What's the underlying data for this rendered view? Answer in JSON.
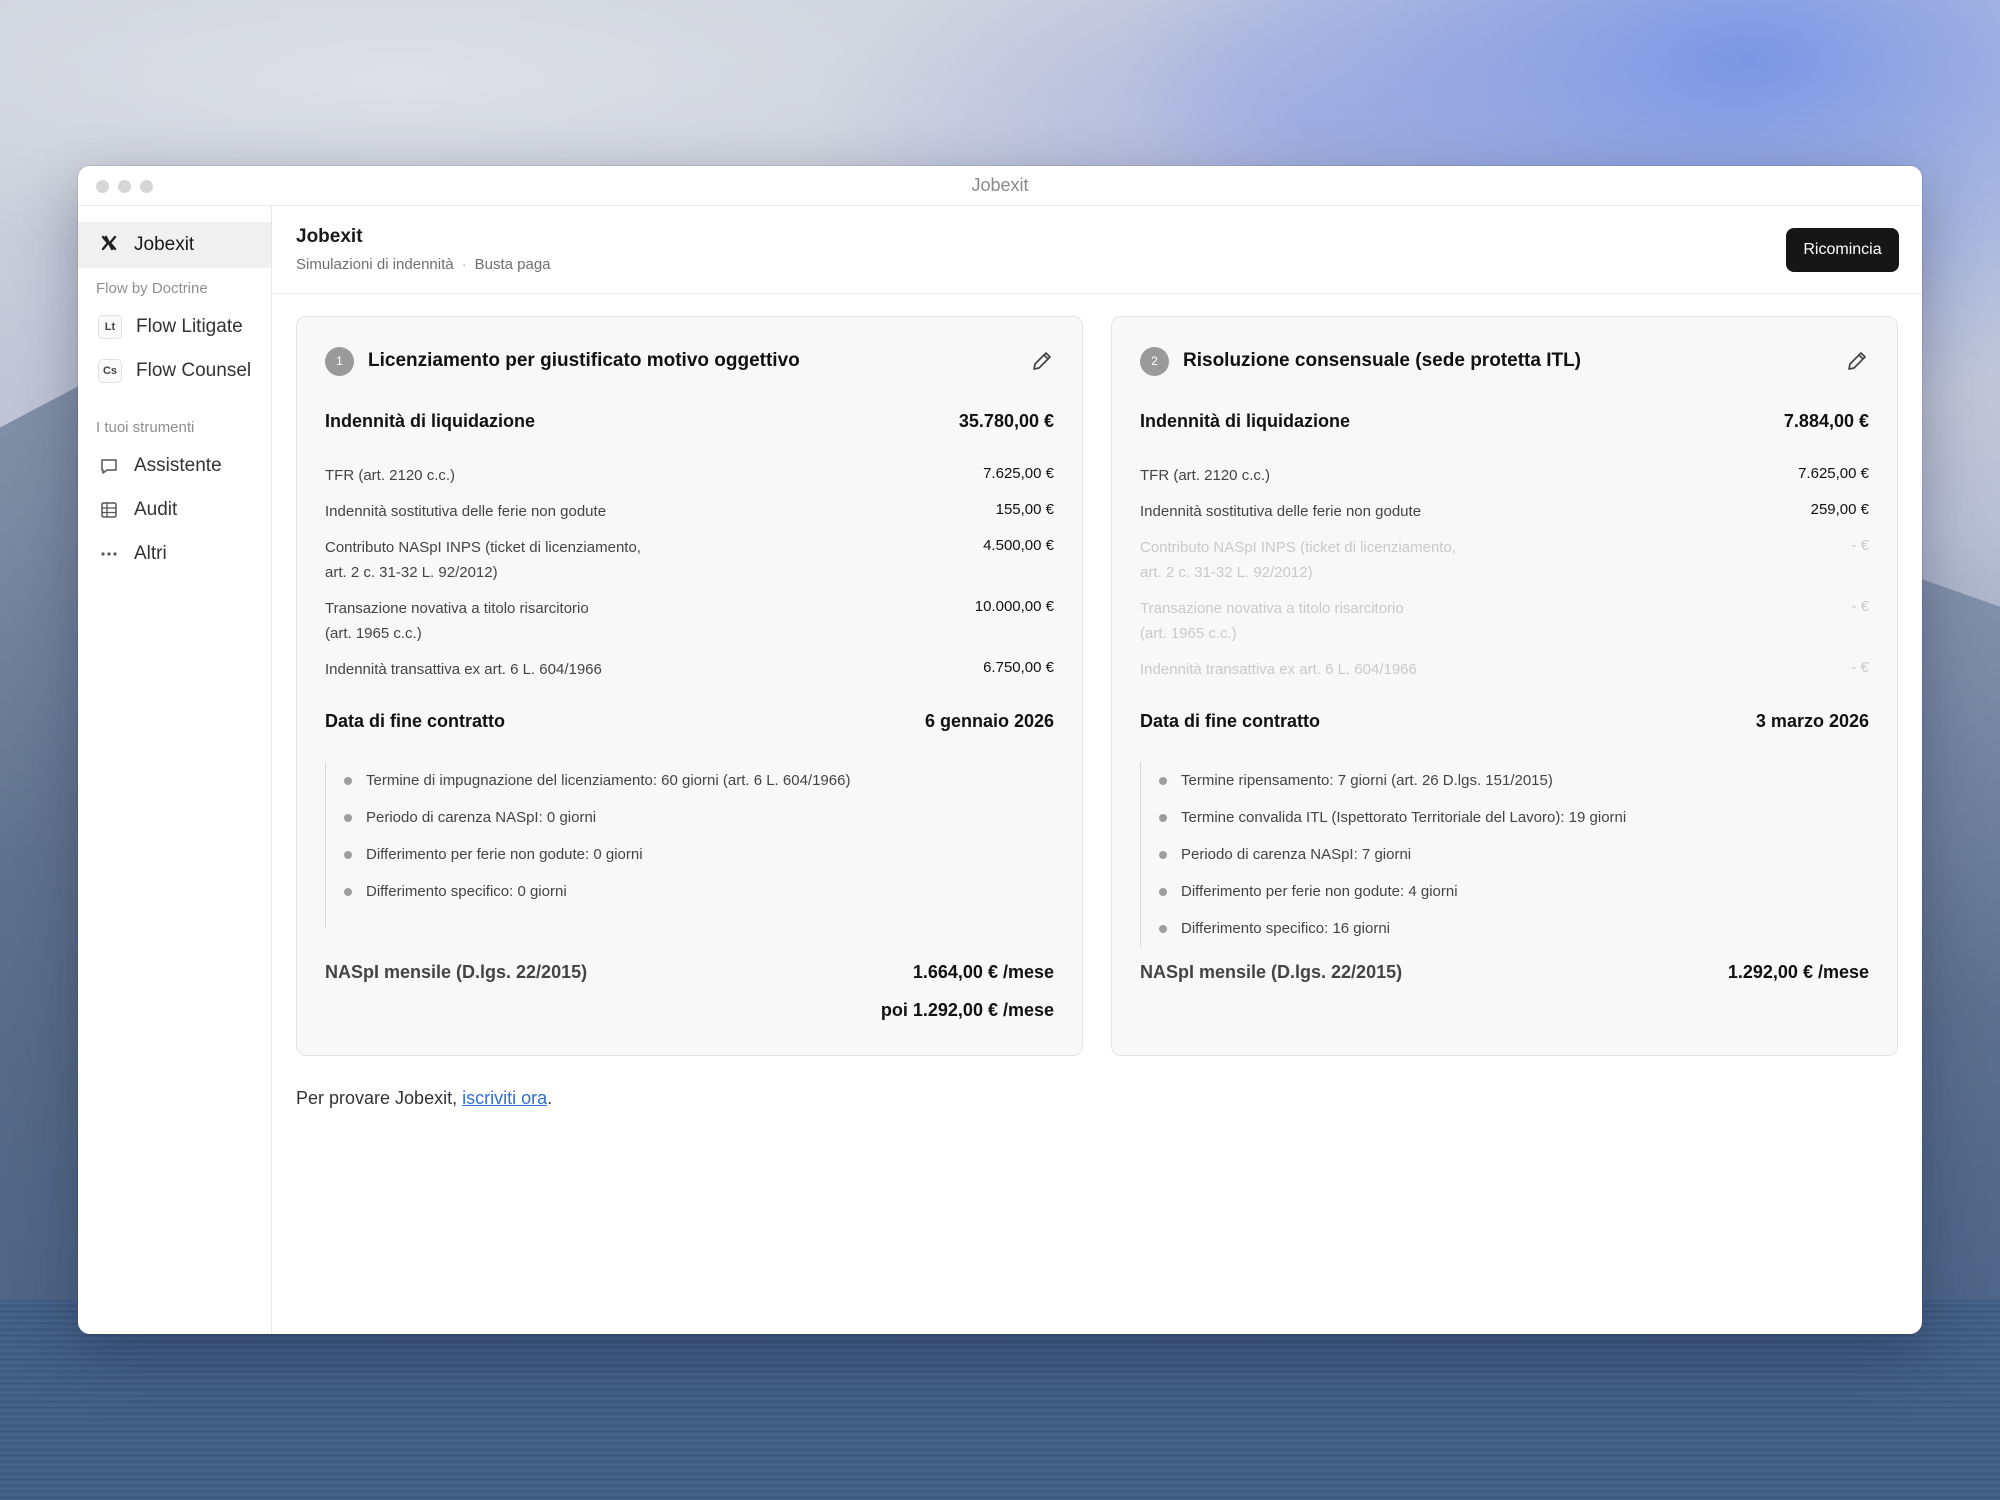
{
  "window": {
    "title": "Jobexit"
  },
  "sidebar": {
    "home": {
      "label": "Jobexit",
      "icon": "x-logo-icon"
    },
    "section_flow": "Flow by Doctrine",
    "flow_items": [
      {
        "badge": "Lt",
        "label": "Flow Litigate"
      },
      {
        "badge": "Cs",
        "label": "Flow Counsel"
      }
    ],
    "section_tools": "I tuoi strumenti",
    "tool_items": [
      {
        "icon": "chat-bubble-icon",
        "label": "Assistente"
      },
      {
        "icon": "table-icon",
        "label": "Audit"
      },
      {
        "icon": "more-dots-icon",
        "label": "Altri"
      }
    ]
  },
  "header": {
    "title": "Jobexit",
    "breadcrumb": [
      "Simulazioni di indennità",
      "·",
      "Busta paga"
    ],
    "restart_label": "Ricomincia"
  },
  "cards": [
    {
      "number": "1",
      "title": "Licenziamento per giustificato motivo oggettivo",
      "severance_label": "Indennità di liquidazione",
      "severance_total": "35.780,00 €",
      "items": [
        {
          "label": "TFR (art. 2120 c.c.)",
          "value": "7.625,00 €",
          "active": true
        },
        {
          "label": "Indennità sostitutiva delle ferie non godute",
          "value": "155,00 €",
          "active": true
        },
        {
          "label": "Contributo NASpI INPS (ticket di licenziamento,",
          "label2": "art. 2 c. 31-32 L. 92/2012)",
          "value": "4.500,00 €",
          "active": true
        },
        {
          "label": "Transazione novativa a titolo risarcitorio",
          "label2": "(art. 1965 c.c.)",
          "value": "10.000,00 €",
          "active": true
        },
        {
          "label": "Indennità transattiva ex art. 6 L. 604/1966",
          "value": "6.750,00 €",
          "active": true
        }
      ],
      "end_label": "Data di fine contratto",
      "end_date": "6 gennaio 2026",
      "bullets": [
        "Termine di impugnazione del licenziamento: 60 giorni (art. 6 L. 604/1966)",
        "Periodo di carenza NASpI: 0 giorni",
        "Differimento per ferie non godute: 0 giorni",
        "Differimento specifico: 0 giorni"
      ],
      "naspi_label": "NASpI mensile (D.lgs. 22/2015)",
      "naspi_value": "1.664,00 € /mese",
      "naspi_value2": "poi 1.292,00 € /mese"
    },
    {
      "number": "2",
      "title": "Risoluzione consensuale (sede protetta ITL)",
      "severance_label": "Indennità di liquidazione",
      "severance_total": "7.884,00 €",
      "items": [
        {
          "label": "TFR (art. 2120 c.c.)",
          "value": "7.625,00 €",
          "active": true
        },
        {
          "label": "Indennità sostitutiva delle ferie non godute",
          "value": "259,00 €",
          "active": true
        },
        {
          "label": "Contributo NASpI INPS (ticket di licenziamento,",
          "label2": "art. 2 c. 31-32 L. 92/2012)",
          "value": "- €",
          "active": false
        },
        {
          "label": "Transazione novativa a titolo risarcitorio",
          "label2": "(art. 1965 c.c.)",
          "value": "- €",
          "active": false
        },
        {
          "label": "Indennità transattiva ex art. 6 L. 604/1966",
          "value": "- €",
          "active": false
        }
      ],
      "end_label": "Data di fine contratto",
      "end_date": "3 marzo 2026",
      "bullets": [
        "Termine ripensamento: 7 giorni (art. 26 D.lgs. 151/2015)",
        "Termine convalida ITL (Ispettorato Territoriale del Lavoro): 19 giorni",
        "Periodo di carenza NASpI: 7 giorni",
        "Differimento per ferie non godute: 4 giorni",
        "Differimento specifico: 16 giorni"
      ],
      "naspi_label": "NASpI mensile (D.lgs. 22/2015)",
      "naspi_value": "1.292,00 € /mese"
    }
  ],
  "footer": {
    "prefix": "Per provare Jobexit, ",
    "link": "iscriviti ora",
    "suffix": "."
  }
}
